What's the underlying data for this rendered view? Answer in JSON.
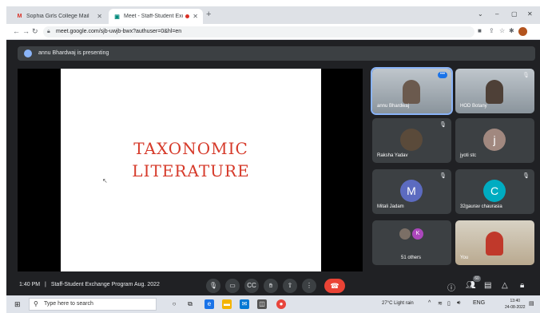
{
  "browser": {
    "tabs": [
      {
        "label": "Sophia Girls College Mail",
        "icon": "gmail-icon"
      },
      {
        "label": "Meet - Staff-Student Exchan",
        "icon": "meet-icon"
      }
    ],
    "url": "meet.google.com/sjb-uwjb-bwx?authuser=0&hl=en"
  },
  "banner": {
    "text": "annu Bhardwaj is presenting"
  },
  "slide": {
    "title": "TAXONOMIC\nLITERATURE",
    "title_color": "#d63a2a"
  },
  "participants": [
    {
      "name": "annu Bhardwaj",
      "type": "video"
    },
    {
      "name": "HOD Botany",
      "type": "video"
    },
    {
      "name": "Raksha Yadav",
      "type": "photo"
    },
    {
      "name": "jyoti stc",
      "type": "initial",
      "initial": "j",
      "color": "#a1887f"
    },
    {
      "name": "Mitali Jadam",
      "type": "initial",
      "initial": "M",
      "color": "#5c6bc0"
    },
    {
      "name": "32gaurav chaurasia",
      "type": "initial",
      "initial": "C",
      "color": "#00acc1"
    },
    {
      "name": "51 others",
      "type": "others",
      "initial": "K"
    },
    {
      "name": "You",
      "type": "video"
    }
  ],
  "meeting": {
    "time": "1:40 PM",
    "separator": "|",
    "title": "Staff-Student Exchange Program Aug. 2022",
    "participant_count": "60"
  },
  "taskbar": {
    "search_placeholder": "Type here to search",
    "weather": "27°C  Light rain",
    "language": "ENG",
    "time": "13:40",
    "date": "24-08-2022"
  },
  "colors": {
    "end_call": "#ea4335",
    "accent": "#8ab4f8",
    "meet_bg": "#202124"
  }
}
